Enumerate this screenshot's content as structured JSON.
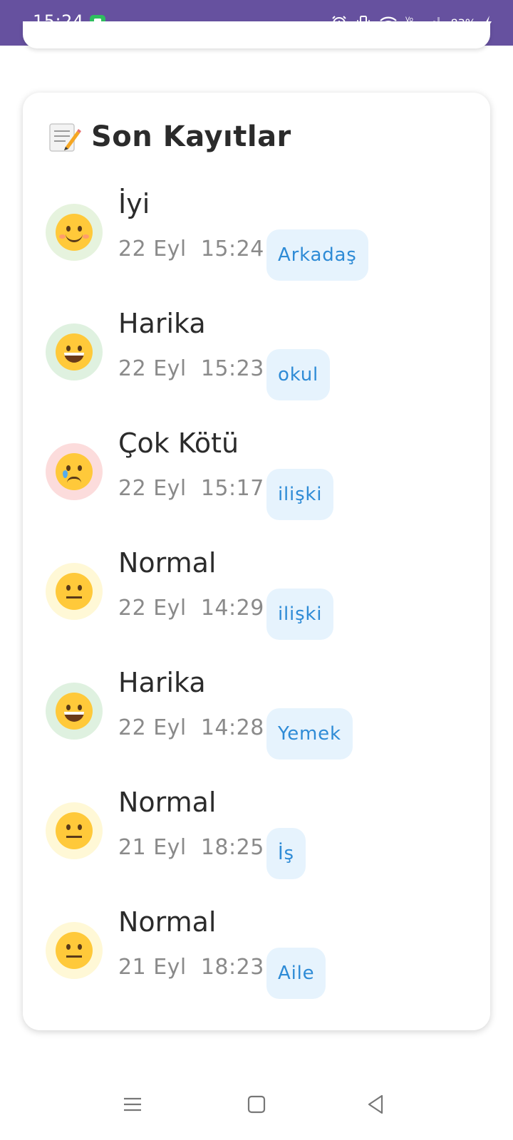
{
  "status_bar": {
    "time": "15:24",
    "battery": "83%",
    "icons": [
      "shield-app-icon",
      "alarm-icon",
      "vibrate-icon",
      "wifi-icon",
      "volte-icon",
      "signal-icon",
      "charging-icon"
    ],
    "background": "#66519f"
  },
  "card": {
    "title": "Son Kayıtlar",
    "title_icon": "memo-icon"
  },
  "entries": [
    {
      "mood": "İyi",
      "date": "22 Eyl",
      "time": "15:24",
      "tag": "Arkadaş",
      "face": "smile",
      "circle_color": "#e6f3de"
    },
    {
      "mood": "Harika",
      "date": "22 Eyl",
      "time": "15:23",
      "tag": "okul",
      "face": "grin",
      "circle_color": "#dff1e0"
    },
    {
      "mood": "Çok Kötü",
      "date": "22 Eyl",
      "time": "15:17",
      "tag": "ilişki",
      "face": "cry",
      "circle_color": "#fcdcdc"
    },
    {
      "mood": "Normal",
      "date": "22 Eyl",
      "time": "14:29",
      "tag": "ilişki",
      "face": "neutral",
      "circle_color": "#fff8d6"
    },
    {
      "mood": "Harika",
      "date": "22 Eyl",
      "time": "14:28",
      "tag": "Yemek",
      "face": "grin",
      "circle_color": "#dff1e0"
    },
    {
      "mood": "Normal",
      "date": "21 Eyl",
      "time": "18:25",
      "tag": "İş",
      "face": "neutral",
      "circle_color": "#fff8d6"
    },
    {
      "mood": "Normal",
      "date": "21 Eyl",
      "time": "18:23",
      "tag": "Aile",
      "face": "neutral",
      "circle_color": "#fff8d6"
    }
  ],
  "nav_bar": {
    "buttons": [
      "menu-icon",
      "home-icon",
      "back-icon"
    ]
  }
}
